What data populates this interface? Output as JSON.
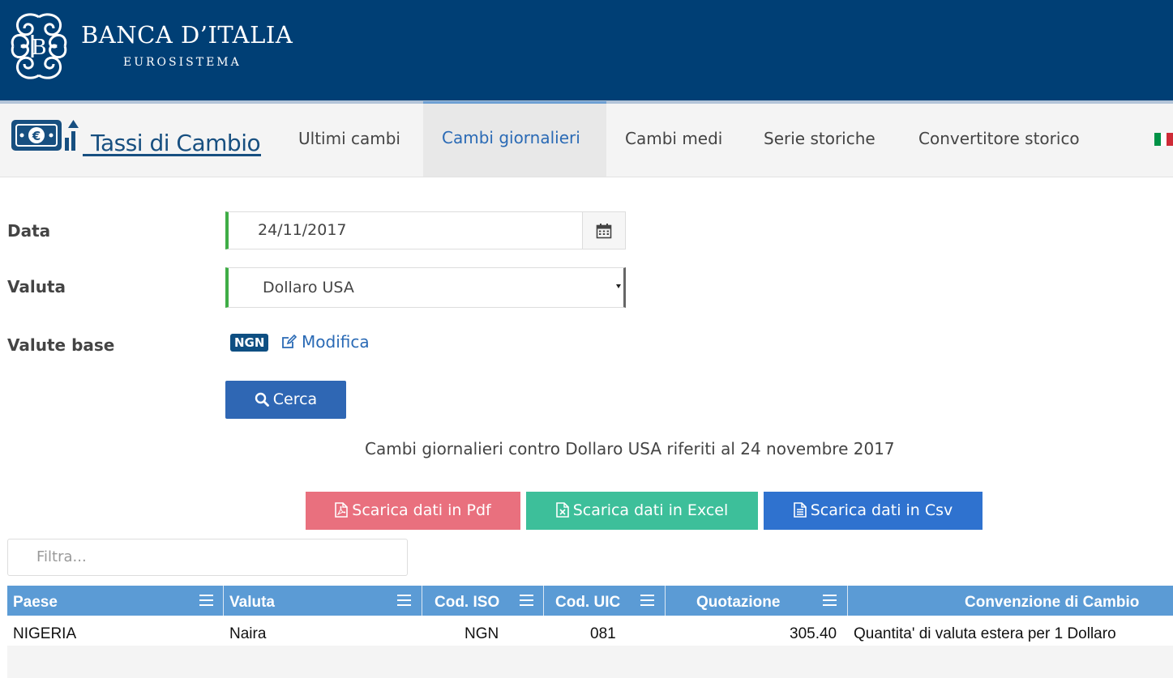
{
  "header": {
    "brand_name": "BANCA D’ITALIA",
    "brand_sub": "EUROSISTEMA"
  },
  "nav": {
    "app_title": "Tassi di Cambio",
    "items": [
      {
        "label": "Ultimi cambi",
        "active": false
      },
      {
        "label": "Cambi giornalieri",
        "active": true
      },
      {
        "label": "Cambi medi",
        "active": false
      },
      {
        "label": "Serie storiche",
        "active": false
      },
      {
        "label": "Convertitore storico",
        "active": false
      }
    ],
    "language_icon": "flag-italy-icon"
  },
  "form": {
    "date_label": "Data",
    "date_value": "24/11/2017",
    "currency_label": "Valuta",
    "currency_value": "Dollaro USA",
    "base_label": "Valute base",
    "base_badge": "NGN",
    "edit_label": "Modifica",
    "search_label": "Cerca"
  },
  "results": {
    "caption": "Cambi giornalieri contro Dollaro USA riferiti al 24 novembre 2017",
    "download_pdf": "Scarica dati in Pdf",
    "download_excel": "Scarica dati in Excel",
    "download_csv": "Scarica dati in Csv",
    "filter_placeholder": "Filtra..."
  },
  "table": {
    "columns": [
      "Paese",
      "Valuta",
      "Cod. ISO",
      "Cod. UIC",
      "Quotazione",
      "Convenzione di Cambio"
    ],
    "rows": [
      [
        "NIGERIA",
        "Naira",
        "NGN",
        "081",
        "305.40",
        "Quantita' di valuta estera per 1 Dollaro"
      ]
    ]
  },
  "colors": {
    "header_bg": "#003f75",
    "accent_blue": "#2a6ab5",
    "valid_green": "#3fad46",
    "pdf_btn": "#e9707e",
    "excel_btn": "#3dbf9a",
    "csv_btn": "#2f72cf",
    "table_header": "#5b9bd5"
  }
}
